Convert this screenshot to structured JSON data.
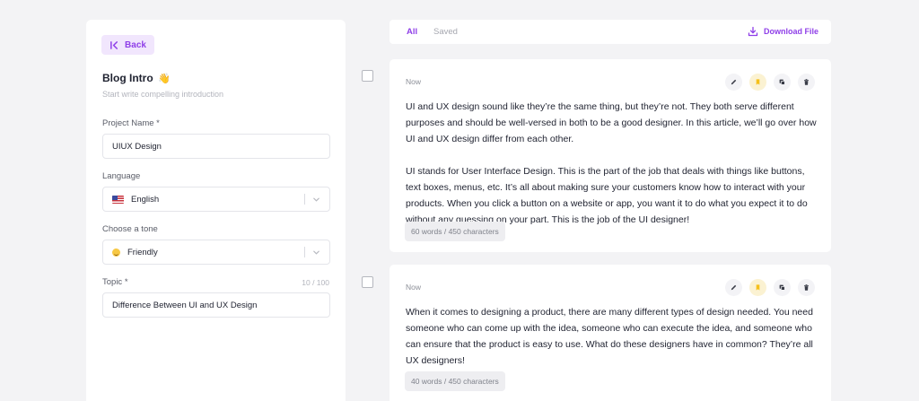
{
  "form": {
    "back_label": "Back",
    "title": "Blog Intro",
    "title_emoji": "👋",
    "subtitle": "Start write compelling introduction",
    "project_label": "Project Name *",
    "project_value": "UIUX Design",
    "language_label": "Language",
    "language_value": "English",
    "tone_label": "Choose a tone",
    "tone_value": "Friendly",
    "topic_label": "Topic *",
    "topic_counter": "10 / 100",
    "topic_value": "Difference Between UI and UX Design"
  },
  "tabs": {
    "all": "All",
    "saved": "Saved"
  },
  "download_label": "Download File",
  "colors": {
    "accent": "#8f3fe8",
    "bookmark": "#f5c01a"
  },
  "results": [
    {
      "time": "Now",
      "paragraphs": [
        "UI and UX design sound like they’re the same thing, but they’re not. They both serve different purposes and should be well-versed in both to be a good designer. In this article, we’ll go over how UI and UX design differ from each other.",
        "UI stands for User Interface Design. This is the part of the job that deals with things like buttons, text boxes, menus, etc. It’s all about making sure your customers know how to interact with your products. When you click a button on a website or app, you want it to do what you expect it to do without any guessing on your part. This is the job of the UI designer!"
      ],
      "count": "60 words / 450 characters"
    },
    {
      "time": "Now",
      "paragraphs": [
        "When it comes to designing a product, there are many different types of design needed. You need someone who can come up with the idea, someone who can execute the idea, and someone who can ensure that the product is easy to use. What do these designers have in common? They’re all UX designers!"
      ],
      "count": "40 words / 450 characters"
    }
  ]
}
